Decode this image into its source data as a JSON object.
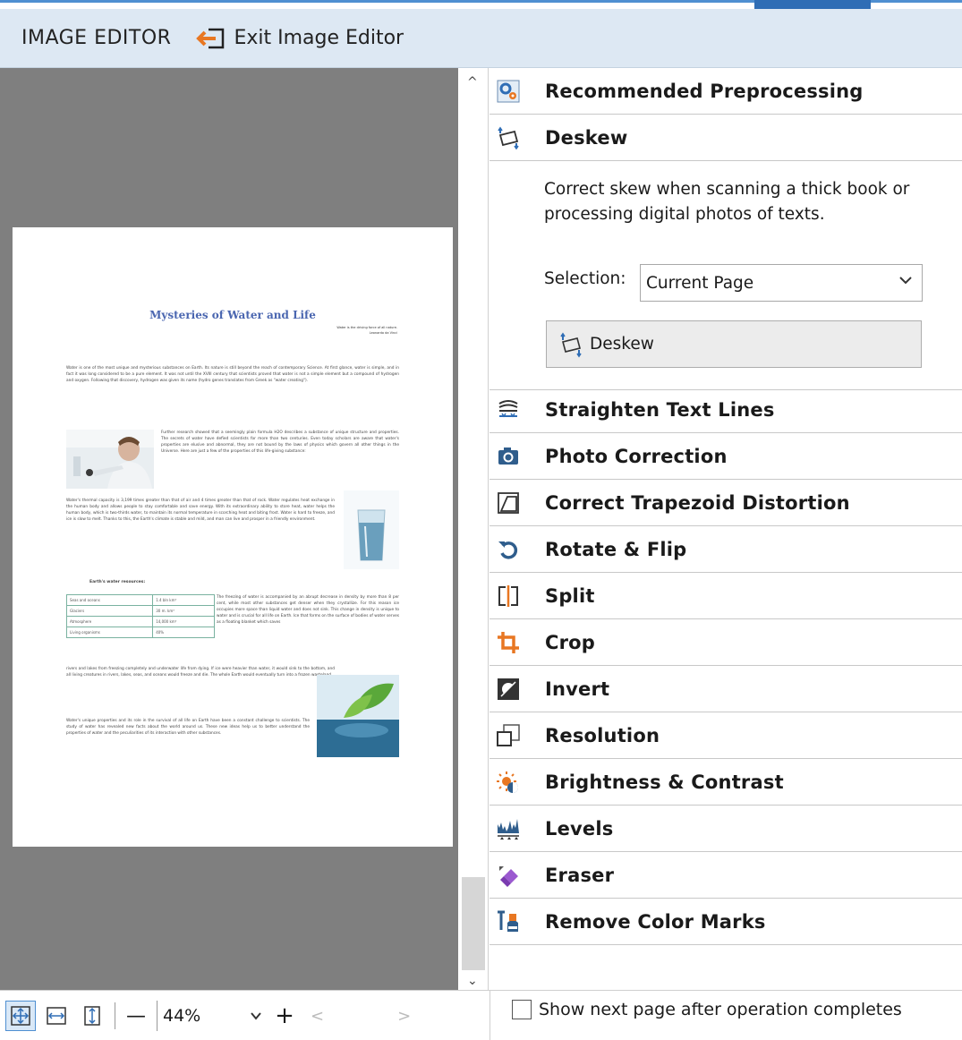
{
  "header": {
    "app_title": "IMAGE EDITOR",
    "exit_label": "Exit Image Editor"
  },
  "document": {
    "title": "Mysteries of Water and Life",
    "quote": "Water is the driving force of all nature.",
    "quote_author": "Leonardo da Vinci",
    "para1": "Water is one of the most unique and mysterious substances on Earth. Its nature is still beyond the reach of contemporary Science. At first glance, water is simple, and in fact it was long considered to be a pure element. It was not until the XVIII century that scientists proved that water is not a simple element but a compound of hydrogen and oxygen. Following that discovery, hydrogen was given its name (hydro genes translates from Greek as \"water creating\").",
    "para2": "Further research showed that a seemingly plain formula H2O describes a substance of unique structure and properties. The secrets of water have defied scientists for more than two centuries. Even today scholars are aware that water's properties are elusive and abnormal, they are not bound by the laws of physics which govern all other things in the Universe. Here are just a few of the properties of this life-giving substance:",
    "para3": "Water's thermal capacity is 3,199 times greater than that of air and 4 times greater than that of rock. Water regulates heat exchange in the human body and allows people to stay comfortable and save energy. With its extraordinary ability to store heat, water helps the human body, which is two-thirds water, to maintain its normal temperature in scorching heat and biting frost. Water is hard to freeze, and ice is slow to melt. Thanks to this, the Earth's climate is stable and mild, and man can live and prosper in a friendly environment.",
    "table_caption": "Earth's water resources:",
    "table_rows": [
      [
        "Seas and oceans",
        "1.4 bln km³"
      ],
      [
        "Glaciers",
        "30 m. km³"
      ],
      [
        "Atmosphere",
        "14,000 km³"
      ],
      [
        "Living organisms",
        "40%"
      ]
    ],
    "para4": "The freezing of water is accompanied by an abrupt decrease in density by more than 8 per cent, while most other substances get denser when they crystallize. For this reason ice occupies more space than liquid water and does not sink. This change in density is unique to water and is crucial for all life on Earth. Ice that forms on the surface of bodies of water serves as a floating blanket which saves",
    "para5": "rivers and lakes from freezing completely and underwater life from dying. If ice were heavier than water, it would sink to the bottom, and all living creatures in rivers, lakes, seas, and oceans would freeze and die. The whole Earth would eventually turn into a frozen wasteland.",
    "para6": "Water's unique properties and its role in the survival of all life on Earth have been a constant challenge to scientists. The study of water has revealed new facts about the world around us. These new ideas help us to better understand the properties of water and the peculiarities of its interaction with other substances."
  },
  "panel": {
    "items": [
      {
        "label": "Recommended Preprocessing",
        "icon": "gears-icon"
      },
      {
        "label": "Deskew",
        "icon": "deskew-icon"
      },
      {
        "label": "Straighten Text Lines",
        "icon": "straighten-lines-icon"
      },
      {
        "label": "Photo Correction",
        "icon": "camera-icon"
      },
      {
        "label": "Correct Trapezoid Distortion",
        "icon": "trapezoid-icon"
      },
      {
        "label": "Rotate & Flip",
        "icon": "rotate-icon"
      },
      {
        "label": "Split",
        "icon": "split-icon"
      },
      {
        "label": "Crop",
        "icon": "crop-icon"
      },
      {
        "label": "Invert",
        "icon": "invert-icon"
      },
      {
        "label": "Resolution",
        "icon": "resolution-icon"
      },
      {
        "label": "Brightness & Contrast",
        "icon": "brightness-icon"
      },
      {
        "label": "Levels",
        "icon": "levels-icon"
      },
      {
        "label": "Eraser",
        "icon": "eraser-icon"
      },
      {
        "label": "Remove Color Marks",
        "icon": "remove-color-marks-icon"
      }
    ],
    "deskew": {
      "description": "Correct skew when scanning a thick book or processing digital photos of texts.",
      "selection_label": "Selection:",
      "selection_value": "Current Page",
      "button_label": "Deskew"
    }
  },
  "footer": {
    "zoom_value": "44%",
    "zoom_minus": "—",
    "zoom_plus": "+",
    "scroll_left": "<",
    "scroll_right": ">",
    "show_next_page_label": "Show next page after operation completes",
    "show_next_page_checked": false
  },
  "colors": {
    "header_bg": "#dde8f3",
    "accent_orange": "#e87722",
    "accent_blue": "#2f6db5",
    "viewer_bg": "#7f7f7f"
  }
}
